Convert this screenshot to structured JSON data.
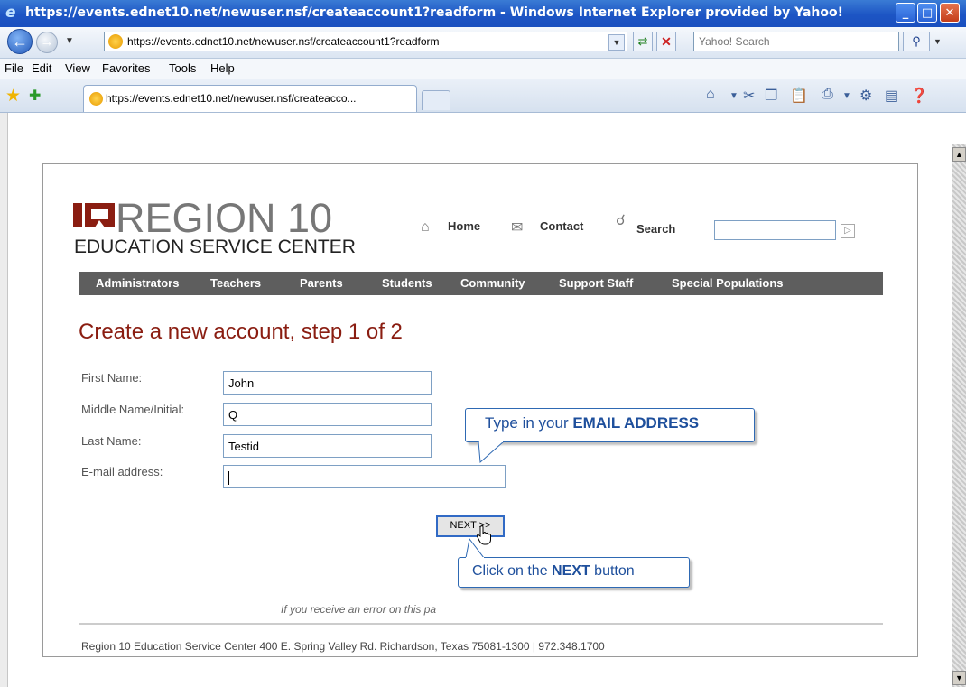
{
  "window": {
    "title": "https://events.ednet10.net/newuser.nsf/createaccount1?readform - Windows Internet Explorer provided by Yahoo!",
    "minimize": "_",
    "maximize": "□",
    "close": "✕"
  },
  "toolbar": {
    "address": "https://events.ednet10.net/newuser.nsf/createaccount1?readform",
    "search_placeholder": "Yahoo! Search"
  },
  "menu": [
    "File",
    "Edit",
    "View",
    "Favorites",
    "Tools",
    "Help"
  ],
  "tab": {
    "title": "https://events.ednet10.net/newuser.nsf/createacco..."
  },
  "site": {
    "logo_main": "REGION 10",
    "logo_sub": "EDUCATION SERVICE CENTER",
    "util_links": {
      "home": "Home",
      "contact": "Contact",
      "search": "Search"
    },
    "nav": [
      "Administrators",
      "Teachers",
      "Parents",
      "Students",
      "Community",
      "Support Staff",
      "Special Populations"
    ]
  },
  "form": {
    "heading": "Create a new account, step 1 of 2",
    "first_name": {
      "label": "First Name:",
      "value": "John"
    },
    "middle_name": {
      "label": "Middle Name/Initial:",
      "value": "Q"
    },
    "last_name": {
      "label": "Last Name:",
      "value": "Testid"
    },
    "email": {
      "label": "E-mail address:",
      "value": ""
    },
    "next_label": "NEXT >>"
  },
  "callouts": {
    "email_pre": "Type in your ",
    "email_bold": "EMAIL ADDRESS",
    "next_pre": "Click on the ",
    "next_bold": "NEXT",
    "next_post": " button"
  },
  "note": "If you receive an error on this pa",
  "footer": "Region 10 Education Service Center 400 E. Spring Valley Rd. Richardson, Texas 75081-1300 | 972.348.1700"
}
